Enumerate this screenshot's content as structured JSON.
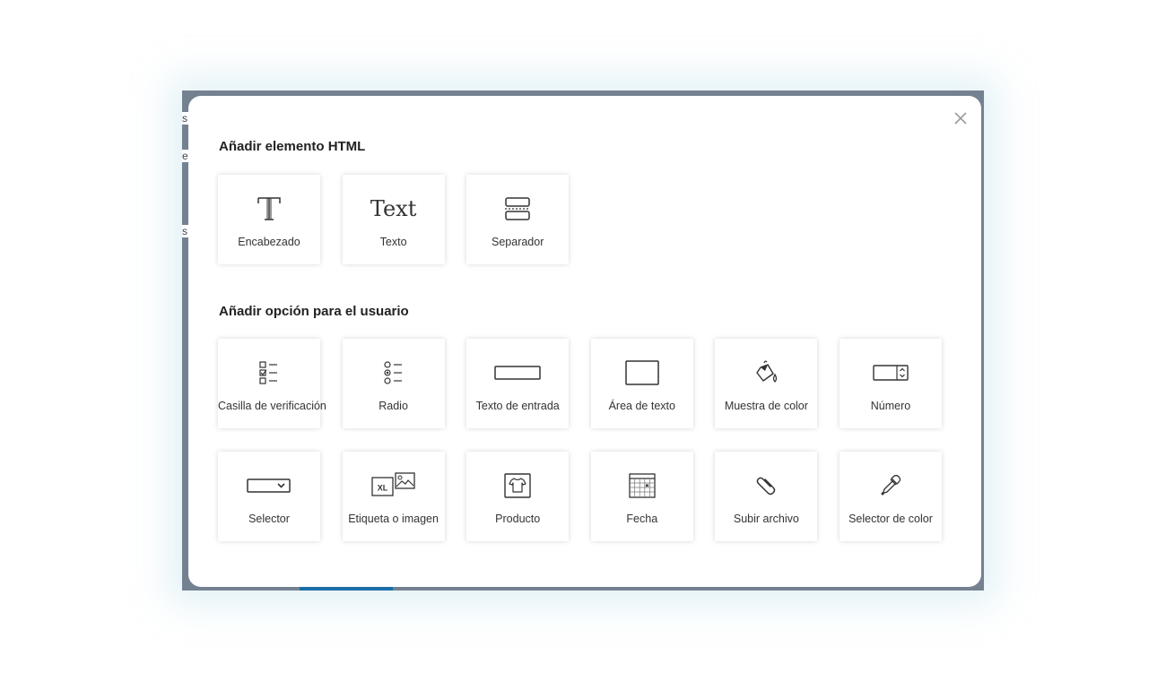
{
  "colors": {
    "backdrop": "#748191",
    "accent_bar": "#1b6ea8",
    "modal_bg": "#ffffff",
    "icon": "#333333"
  },
  "backdrop": {
    "fragments": [
      "s",
      "e",
      "s"
    ]
  },
  "modal": {
    "close_icon": "close-icon",
    "sections": [
      {
        "title": "Añadir elemento HTML",
        "items": [
          {
            "label": "Encabezado",
            "icon": "heading-icon"
          },
          {
            "label": "Texto",
            "icon": "text-icon",
            "glyph": "Text"
          },
          {
            "label": "Separador",
            "icon": "separator-icon"
          }
        ]
      },
      {
        "title": "Añadir opción para el usuario",
        "items": [
          {
            "label": "Casilla de verificación",
            "icon": "checkbox-list-icon"
          },
          {
            "label": "Radio",
            "icon": "radio-list-icon"
          },
          {
            "label": "Texto de entrada",
            "icon": "text-input-icon"
          },
          {
            "label": "Área de texto",
            "icon": "textarea-icon"
          },
          {
            "label": "Muestra de color",
            "icon": "paint-bucket-icon"
          },
          {
            "label": "Número",
            "icon": "number-stepper-icon"
          },
          {
            "label": "Selector",
            "icon": "dropdown-icon"
          },
          {
            "label": "Etiqueta o imagen",
            "icon": "label-image-icon",
            "badge": "XL"
          },
          {
            "label": "Producto",
            "icon": "tshirt-icon"
          },
          {
            "label": "Fecha",
            "icon": "calendar-icon"
          },
          {
            "label": "Subir archivo",
            "icon": "paperclip-icon"
          },
          {
            "label": "Selector de color",
            "icon": "eyedropper-icon"
          }
        ]
      }
    ]
  }
}
